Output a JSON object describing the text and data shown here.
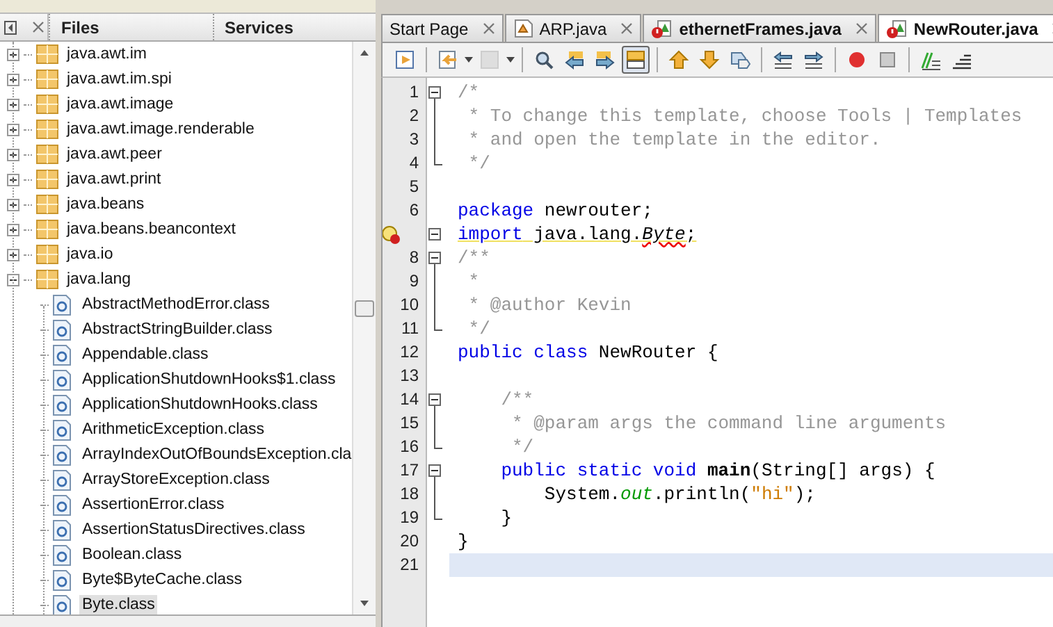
{
  "side_panel": {
    "tabs": [
      {
        "label": "Files"
      },
      {
        "label": "Services"
      }
    ],
    "tree": [
      {
        "label": "java.awt.im",
        "expanded": false,
        "selected": false
      },
      {
        "label": "java.awt.im.spi",
        "expanded": false,
        "selected": false
      },
      {
        "label": "java.awt.image",
        "expanded": false,
        "selected": false
      },
      {
        "label": "java.awt.image.renderable",
        "expanded": false,
        "selected": false
      },
      {
        "label": "java.awt.peer",
        "expanded": false,
        "selected": false
      },
      {
        "label": "java.awt.print",
        "expanded": false,
        "selected": false
      },
      {
        "label": "java.beans",
        "expanded": false,
        "selected": false
      },
      {
        "label": "java.beans.beancontext",
        "expanded": false,
        "selected": false
      },
      {
        "label": "java.io",
        "expanded": false,
        "selected": false
      },
      {
        "label": "java.lang",
        "expanded": true,
        "selected": false,
        "children": [
          {
            "label": "AbstractMethodError.class",
            "selected": false
          },
          {
            "label": "AbstractStringBuilder.class",
            "selected": false
          },
          {
            "label": "Appendable.class",
            "selected": false
          },
          {
            "label": "ApplicationShutdownHooks$1.class",
            "selected": false
          },
          {
            "label": "ApplicationShutdownHooks.class",
            "selected": false
          },
          {
            "label": "ArithmeticException.class",
            "selected": false
          },
          {
            "label": "ArrayIndexOutOfBoundsException.cla",
            "selected": false
          },
          {
            "label": "ArrayStoreException.class",
            "selected": false
          },
          {
            "label": "AssertionError.class",
            "selected": false
          },
          {
            "label": "AssertionStatusDirectives.class",
            "selected": false
          },
          {
            "label": "Boolean.class",
            "selected": false
          },
          {
            "label": "Byte$ByteCache.class",
            "selected": false
          },
          {
            "label": "Byte.class",
            "selected": true
          }
        ]
      }
    ]
  },
  "editor": {
    "tabs": [
      {
        "label": "Start Page",
        "kind": "page",
        "selected": false
      },
      {
        "label": "ARP.java",
        "kind": "java",
        "selected": false
      },
      {
        "label": "ethernetFrames.java",
        "kind": "java-error",
        "selected": false
      },
      {
        "label": "NewRouter.java",
        "kind": "java-error",
        "selected": true
      }
    ],
    "toolbar": [
      {
        "kind": "last-edit",
        "pressed": false
      },
      {
        "kind": "separator"
      },
      {
        "kind": "back",
        "pressed": false
      },
      {
        "kind": "dropdown"
      },
      {
        "kind": "forward",
        "pressed": false,
        "disabled": true
      },
      {
        "kind": "dropdown"
      },
      {
        "kind": "separator"
      },
      {
        "kind": "find",
        "pressed": false
      },
      {
        "kind": "find-prev",
        "pressed": false
      },
      {
        "kind": "find-next",
        "pressed": false
      },
      {
        "kind": "highlight",
        "pressed": true
      },
      {
        "kind": "separator"
      },
      {
        "kind": "up",
        "pressed": false
      },
      {
        "kind": "down",
        "pressed": false
      },
      {
        "kind": "bookmark",
        "pressed": false
      },
      {
        "kind": "separator"
      },
      {
        "kind": "shift-left",
        "pressed": false
      },
      {
        "kind": "shift-right",
        "pressed": false
      },
      {
        "kind": "separator"
      },
      {
        "kind": "record",
        "pressed": false
      },
      {
        "kind": "stop",
        "pressed": false
      },
      {
        "kind": "separator"
      },
      {
        "kind": "comment",
        "pressed": false
      },
      {
        "kind": "uncomment",
        "pressed": false
      }
    ],
    "lines": [
      {
        "number": "1",
        "kind": "fold-start",
        "current": false,
        "tokens": [
          {
            "kind": "comment",
            "text": "/*"
          }
        ]
      },
      {
        "number": "2",
        "kind": "fold-mid",
        "current": false,
        "tokens": [
          {
            "kind": "comment",
            "text": " * To change this template, choose Tools | Templates"
          }
        ]
      },
      {
        "number": "3",
        "kind": "fold-mid",
        "current": false,
        "tokens": [
          {
            "kind": "comment",
            "text": " * and open the template in the editor."
          }
        ]
      },
      {
        "number": "4",
        "kind": "fold-end",
        "current": false,
        "tokens": [
          {
            "kind": "comment",
            "text": " */"
          }
        ]
      },
      {
        "number": "5",
        "kind": "line",
        "current": false
      },
      {
        "number": "6",
        "kind": "line",
        "current": false,
        "tokens": [
          {
            "kind": "keyword",
            "text": "package"
          },
          {
            "kind": "plain",
            "text": " newrouter;"
          }
        ]
      },
      {
        "kind": "fold-single",
        "hint": true,
        "warning": true,
        "current": false,
        "tokens": [
          {
            "kind": "keyword",
            "text": "import"
          },
          {
            "kind": "plain",
            "text": " java.lang."
          },
          {
            "kind": "error",
            "text": "Byte"
          },
          {
            "kind": "plain",
            "text": ";"
          }
        ]
      },
      {
        "number": "8",
        "kind": "fold-start",
        "current": false,
        "tokens": [
          {
            "kind": "comment",
            "text": "/**"
          }
        ]
      },
      {
        "number": "9",
        "kind": "fold-mid",
        "current": false,
        "tokens": [
          {
            "kind": "comment",
            "text": " *"
          }
        ]
      },
      {
        "number": "10",
        "kind": "fold-mid",
        "current": false,
        "tokens": [
          {
            "kind": "comment",
            "text": " * @author Kevin"
          }
        ]
      },
      {
        "number": "11",
        "kind": "fold-end",
        "current": false,
        "tokens": [
          {
            "kind": "comment",
            "text": " */"
          }
        ]
      },
      {
        "number": "12",
        "kind": "line",
        "current": false,
        "tokens": [
          {
            "kind": "keyword",
            "text": "public class"
          },
          {
            "kind": "plain",
            "text": " NewRouter {"
          }
        ]
      },
      {
        "number": "13",
        "kind": "line",
        "current": false
      },
      {
        "number": "14",
        "kind": "fold-start",
        "current": false,
        "tokens": [
          {
            "kind": "comment",
            "text": "    /**"
          }
        ]
      },
      {
        "number": "15",
        "kind": "fold-mid",
        "current": false,
        "tokens": [
          {
            "kind": "comment",
            "text": "     * @param args the command line arguments"
          }
        ]
      },
      {
        "number": "16",
        "kind": "fold-end",
        "current": false,
        "tokens": [
          {
            "kind": "comment",
            "text": "     */"
          }
        ]
      },
      {
        "number": "17",
        "kind": "fold-start",
        "current": false,
        "tokens": [
          {
            "kind": "keyword",
            "text": "    public static void "
          },
          {
            "kind": "method",
            "text": "main"
          },
          {
            "kind": "plain",
            "text": "(String[] args) {"
          }
        ]
      },
      {
        "number": "18",
        "kind": "fold-mid",
        "current": false,
        "tokens": [
          {
            "kind": "plain",
            "text": "        System."
          },
          {
            "kind": "field",
            "text": "out"
          },
          {
            "kind": "plain",
            "text": ".println("
          },
          {
            "kind": "string",
            "text": "\"hi\""
          },
          {
            "kind": "plain",
            "text": ");"
          }
        ]
      },
      {
        "number": "19",
        "kind": "fold-end",
        "current": false,
        "tokens": [
          {
            "kind": "plain",
            "text": "    }"
          }
        ]
      },
      {
        "number": "20",
        "kind": "line",
        "current": false,
        "tokens": [
          {
            "kind": "plain",
            "text": "}"
          }
        ]
      },
      {
        "number": "21",
        "kind": "line",
        "current": true
      }
    ]
  }
}
